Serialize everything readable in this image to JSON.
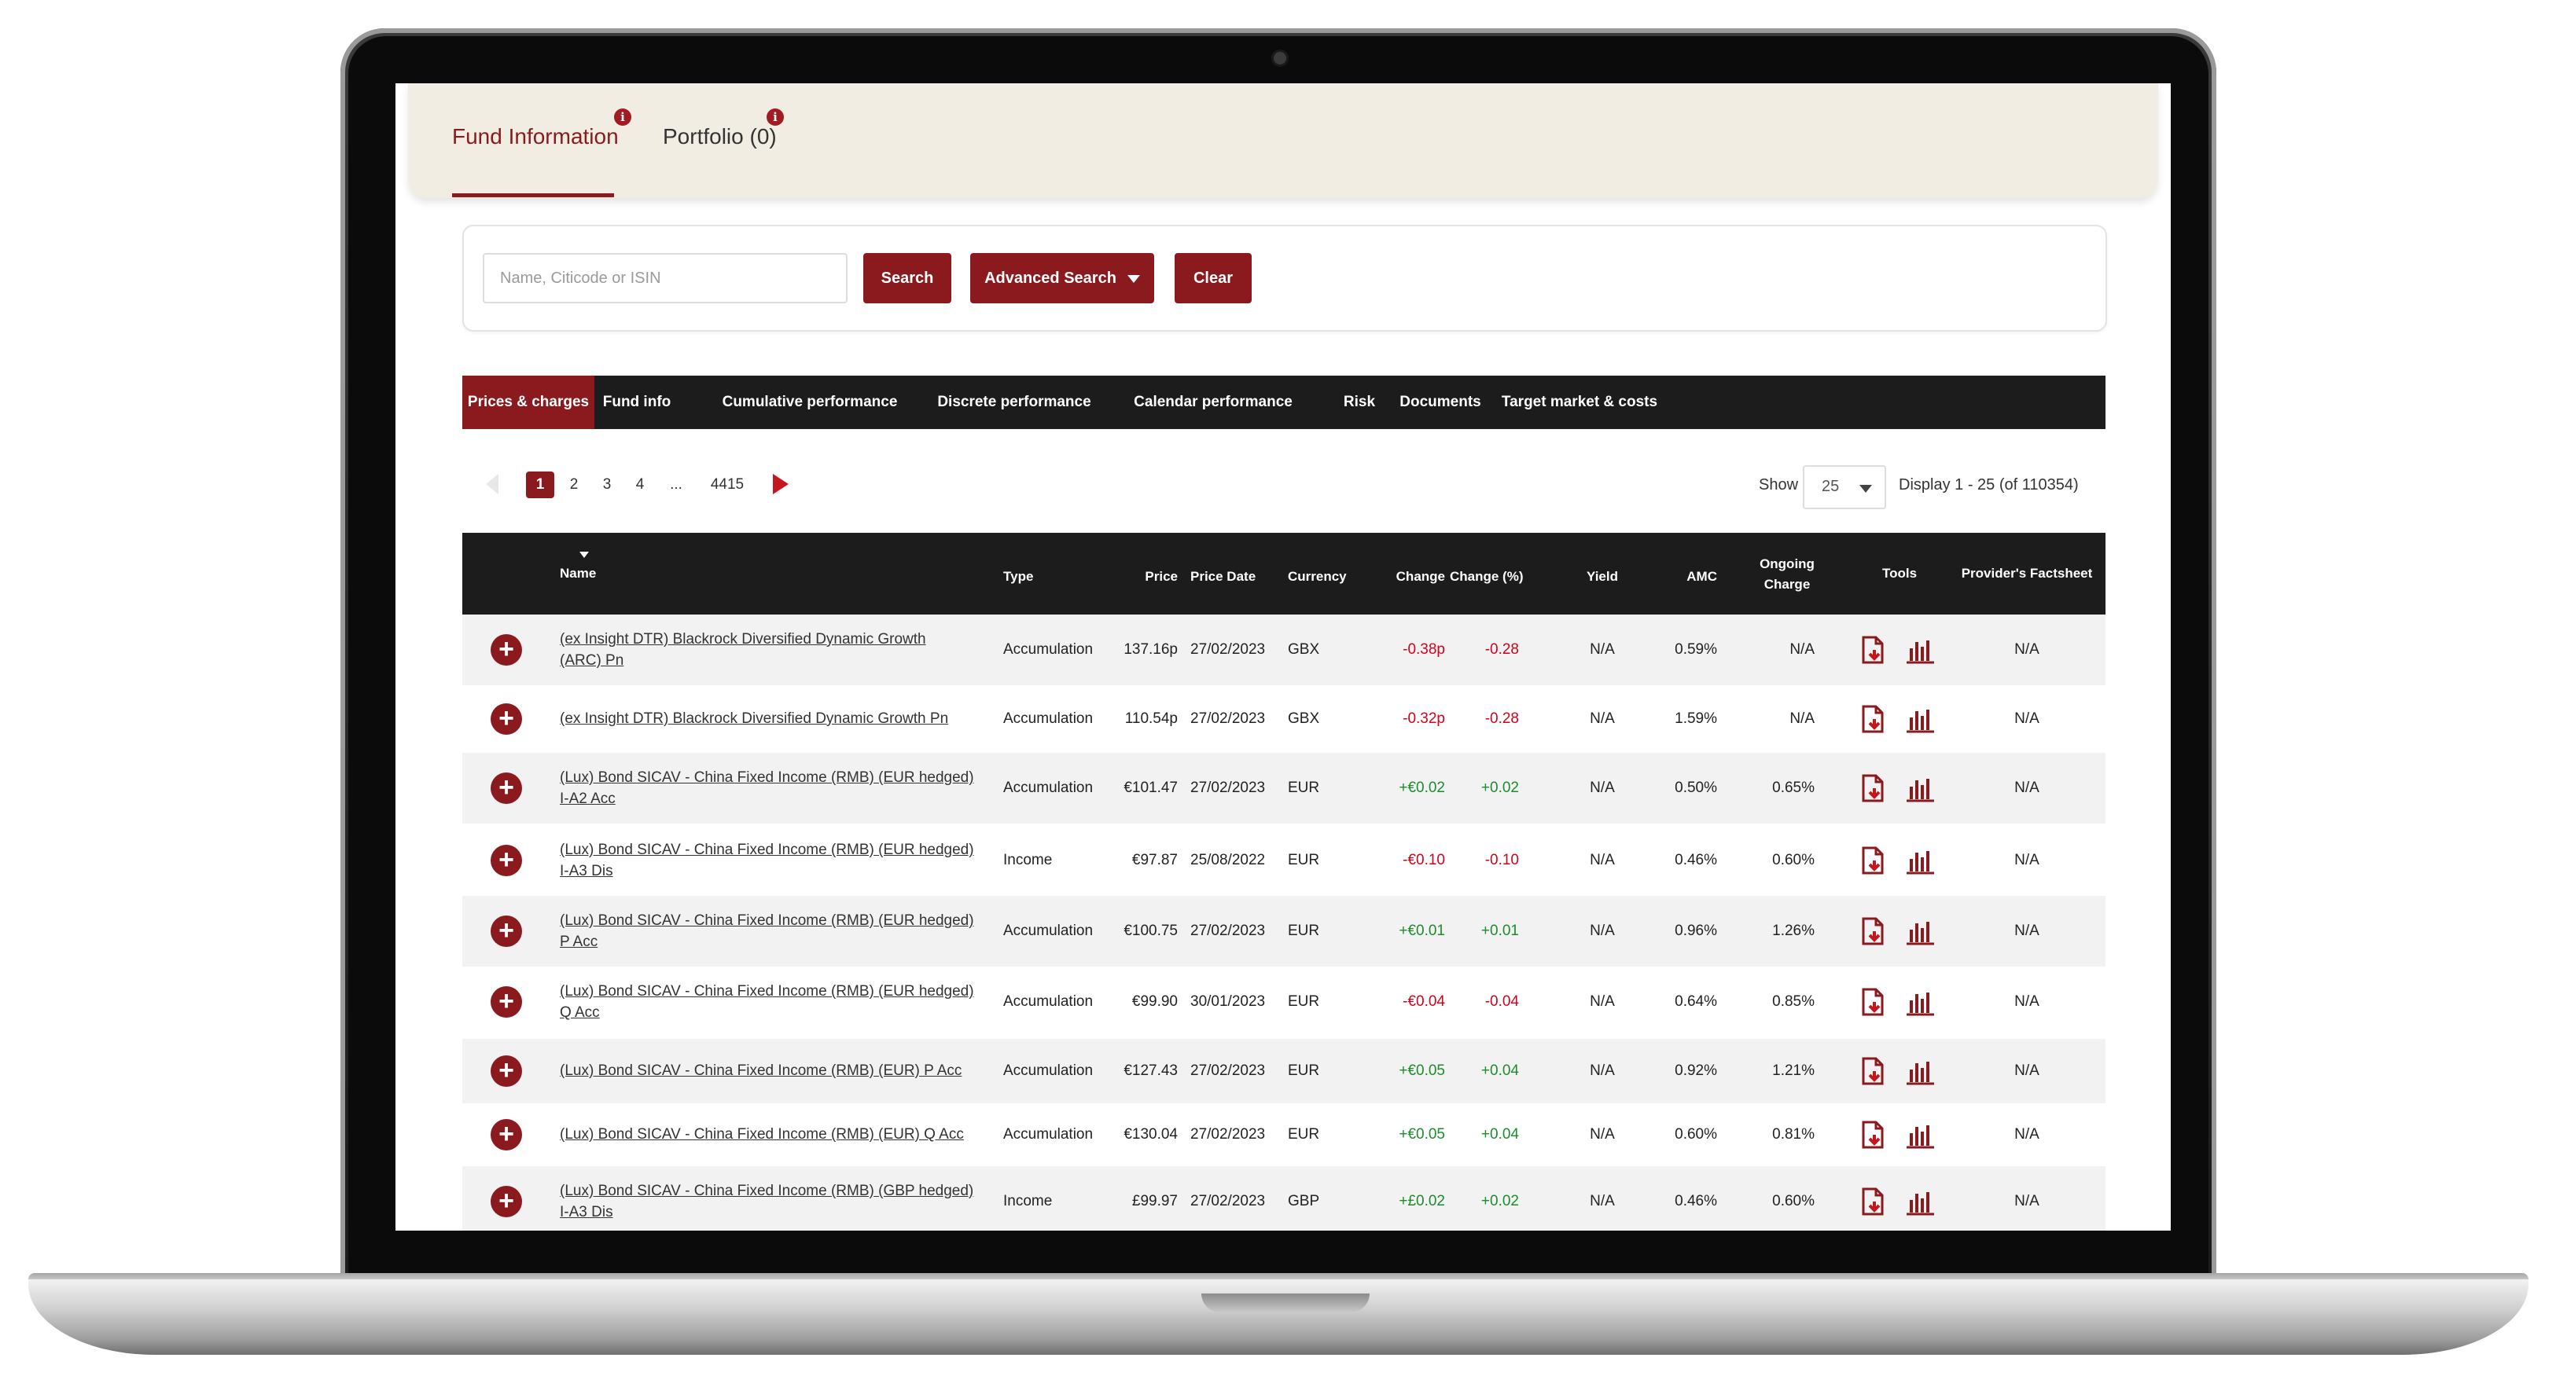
{
  "topbar": {
    "tabs": [
      {
        "label": "Fund Information",
        "active": true
      },
      {
        "label": "Portfolio (0)",
        "active": false
      }
    ]
  },
  "search": {
    "placeholder": "Name, Citicode or ISIN",
    "search_label": "Search",
    "advanced_label": "Advanced Search",
    "clear_label": "Clear"
  },
  "nav": {
    "items": [
      "Prices & charges",
      "Fund info",
      "Cumulative performance",
      "Discrete performance",
      "Calendar performance",
      "Risk",
      "Documents",
      "Target market & costs"
    ]
  },
  "pagination": {
    "pages": [
      "1",
      "2",
      "3",
      "4",
      "...",
      "4415"
    ],
    "current": "1",
    "show_label": "Show",
    "page_size": "25",
    "display_text": "Display 1 - 25 (of 110354)"
  },
  "table": {
    "headers": {
      "name": "Name",
      "type": "Type",
      "price": "Price",
      "price_date": "Price Date",
      "currency": "Currency",
      "change": "Change",
      "change_pct": "Change (%)",
      "yield": "Yield",
      "amc": "AMC",
      "ongoing_1": "Ongoing",
      "ongoing_2": "Charge",
      "tools": "Tools",
      "factsheet": "Provider's Factsheet"
    },
    "rows": [
      {
        "name1": "(ex Insight DTR) Blackrock Diversified Dynamic Growth",
        "name2": "(ARC) Pn",
        "type": "Accumulation",
        "price": "137.16p",
        "date": "27/02/2023",
        "currency": "GBX",
        "change": "-0.38p",
        "change_pct": "-0.28",
        "dir": "neg",
        "yield": "N/A",
        "amc": "0.59%",
        "ongoing": "N/A",
        "factsheet": "N/A"
      },
      {
        "name1": "(ex Insight DTR) Blackrock Diversified Dynamic Growth Pn",
        "name2": "",
        "type": "Accumulation",
        "price": "110.54p",
        "date": "27/02/2023",
        "currency": "GBX",
        "change": "-0.32p",
        "change_pct": "-0.28",
        "dir": "neg",
        "yield": "N/A",
        "amc": "1.59%",
        "ongoing": "N/A",
        "factsheet": "N/A"
      },
      {
        "name1": "(Lux) Bond SICAV - China Fixed Income (RMB) (EUR hedged)",
        "name2": "I-A2 Acc",
        "type": "Accumulation",
        "price": "€101.47",
        "date": "27/02/2023",
        "currency": "EUR",
        "change": "+€0.02",
        "change_pct": "+0.02",
        "dir": "pos",
        "yield": "N/A",
        "amc": "0.50%",
        "ongoing": "0.65%",
        "factsheet": "N/A"
      },
      {
        "name1": "(Lux) Bond SICAV - China Fixed Income (RMB) (EUR hedged)",
        "name2": "I-A3 Dis",
        "type": "Income",
        "price": "€97.87",
        "date": "25/08/2022",
        "currency": "EUR",
        "change": "-€0.10",
        "change_pct": "-0.10",
        "dir": "neg",
        "yield": "N/A",
        "amc": "0.46%",
        "ongoing": "0.60%",
        "factsheet": "N/A"
      },
      {
        "name1": "(Lux) Bond SICAV - China Fixed Income (RMB) (EUR hedged)",
        "name2": "P Acc",
        "type": "Accumulation",
        "price": "€100.75",
        "date": "27/02/2023",
        "currency": "EUR",
        "change": "+€0.01",
        "change_pct": "+0.01",
        "dir": "pos",
        "yield": "N/A",
        "amc": "0.96%",
        "ongoing": "1.26%",
        "factsheet": "N/A"
      },
      {
        "name1": "(Lux) Bond SICAV - China Fixed Income (RMB) (EUR hedged)",
        "name2": "Q Acc",
        "type": "Accumulation",
        "price": "€99.90",
        "date": "30/01/2023",
        "currency": "EUR",
        "change": "-€0.04",
        "change_pct": "-0.04",
        "dir": "neg",
        "yield": "N/A",
        "amc": "0.64%",
        "ongoing": "0.85%",
        "factsheet": "N/A"
      },
      {
        "name1": "(Lux) Bond SICAV - China Fixed Income (RMB) (EUR) P Acc",
        "name2": "",
        "type": "Accumulation",
        "price": "€127.43",
        "date": "27/02/2023",
        "currency": "EUR",
        "change": "+€0.05",
        "change_pct": "+0.04",
        "dir": "pos",
        "yield": "N/A",
        "amc": "0.92%",
        "ongoing": "1.21%",
        "factsheet": "N/A"
      },
      {
        "name1": "(Lux) Bond SICAV - China Fixed Income (RMB) (EUR) Q Acc",
        "name2": "",
        "type": "Accumulation",
        "price": "€130.04",
        "date": "27/02/2023",
        "currency": "EUR",
        "change": "+€0.05",
        "change_pct": "+0.04",
        "dir": "pos",
        "yield": "N/A",
        "amc": "0.60%",
        "ongoing": "0.81%",
        "factsheet": "N/A"
      },
      {
        "name1": "(Lux) Bond SICAV - China Fixed Income (RMB) (GBP hedged)",
        "name2": "I-A3 Dis",
        "type": "Income",
        "price": "£99.97",
        "date": "27/02/2023",
        "currency": "GBP",
        "change": "+£0.02",
        "change_pct": "+0.02",
        "dir": "pos",
        "yield": "N/A",
        "amc": "0.46%",
        "ongoing": "0.60%",
        "factsheet": "N/A"
      }
    ]
  },
  "colors": {
    "brand": "#8b1a1e",
    "negative": "#d0021b",
    "positive": "#1c8c2c",
    "header_bg": "#1c1c1c"
  },
  "icons": {
    "plus": "plus-circle-icon",
    "doc": "document-download-icon",
    "chart": "bar-chart-icon",
    "info": "info-icon"
  }
}
